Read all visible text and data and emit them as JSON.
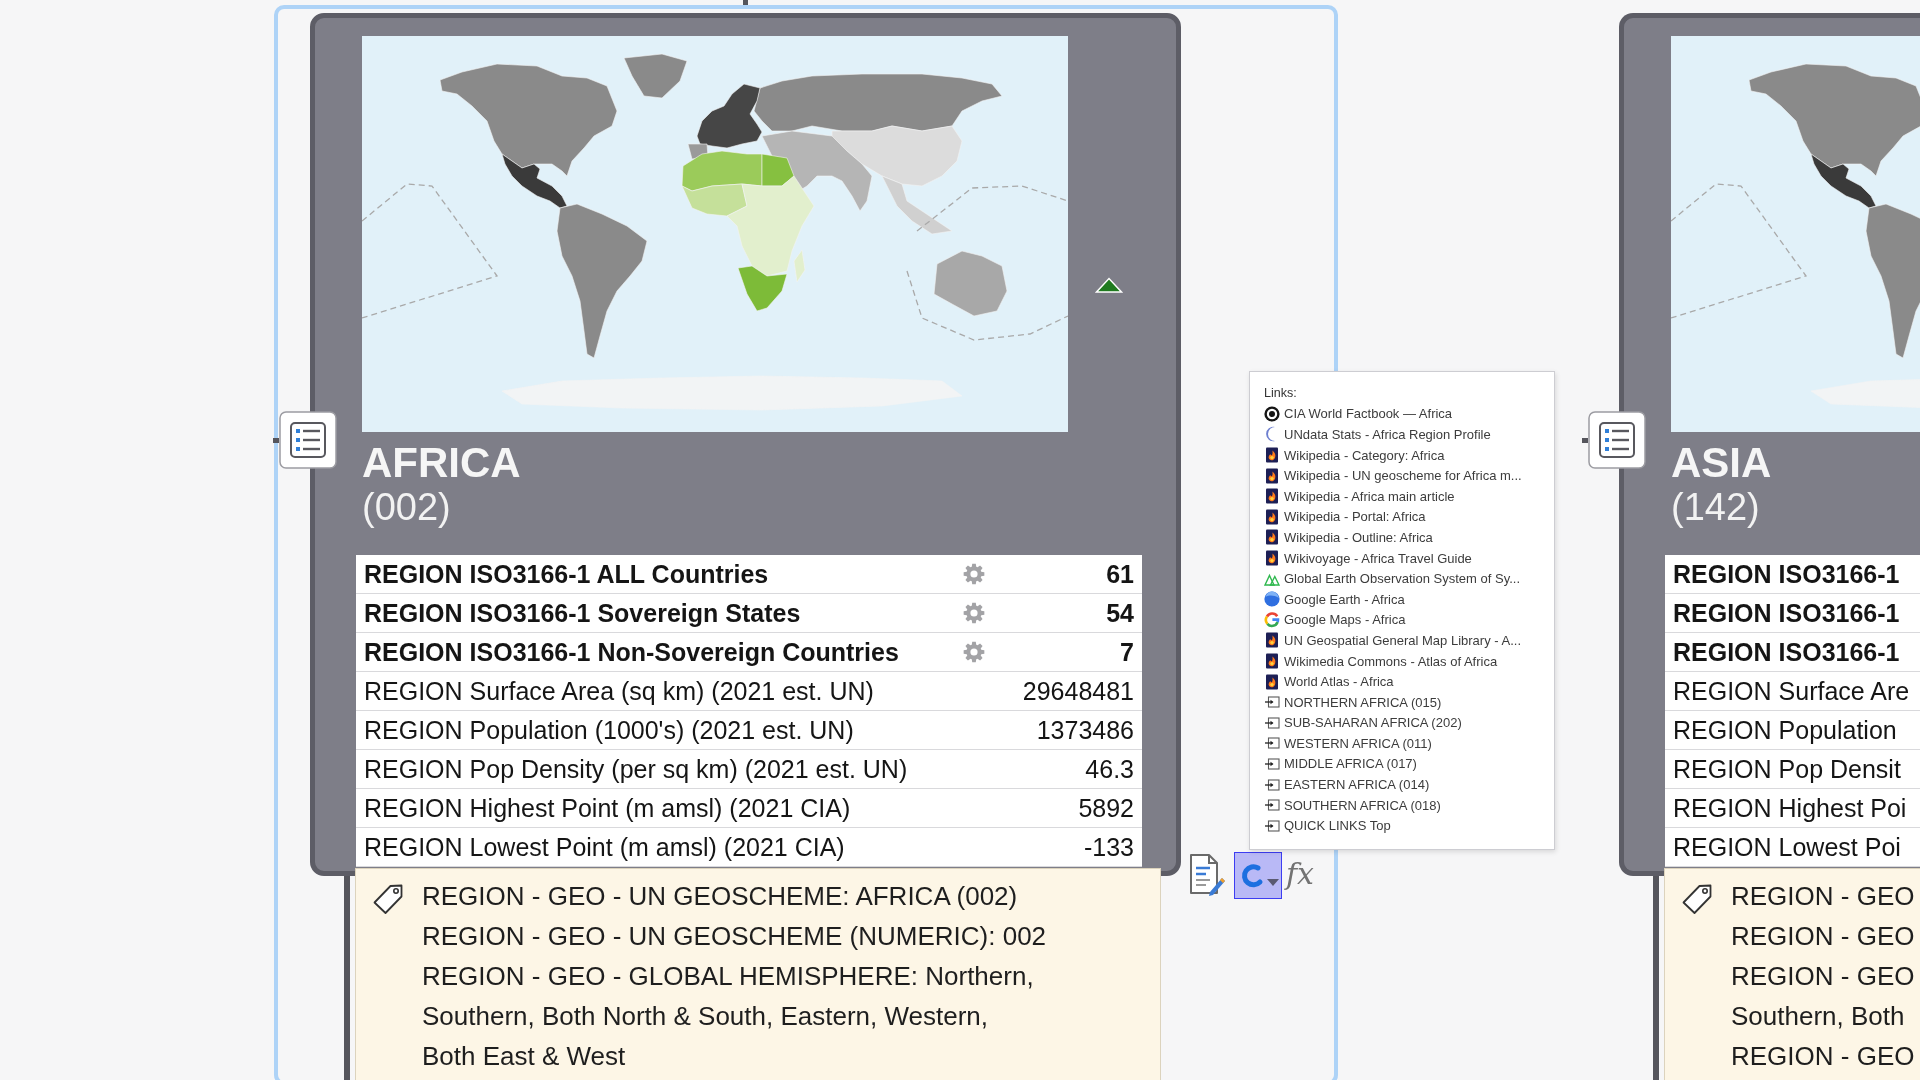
{
  "topics": [
    {
      "title": "AFRICA",
      "code": "(002)",
      "selected": true,
      "collapse_marker": true,
      "stats": [
        {
          "kind": "count",
          "label": "REGION ISO3166-1 ALL Countries",
          "value": "61"
        },
        {
          "kind": "count",
          "label": "REGION ISO3166-1 Sovereign States",
          "value": "54"
        },
        {
          "kind": "count",
          "label": "REGION ISO3166-1 Non-Sovereign Countries",
          "value": "7"
        },
        {
          "kind": "stat",
          "label": "REGION Surface Area (sq km) (2021 est. UN)",
          "value": "29648481"
        },
        {
          "kind": "stat",
          "label": "REGION Population (1000's) (2021 est. UN)",
          "value": "1373486"
        },
        {
          "kind": "stat",
          "label": "REGION Pop Density (per sq km) (2021 est. UN)",
          "value": "46.3"
        },
        {
          "kind": "stat",
          "label": "REGION Highest Point (m amsl) (2021 CIA)",
          "value": "5892"
        },
        {
          "kind": "stat",
          "label": "REGION Lowest Point (m amsl) (2021 CIA)",
          "value": "-133"
        }
      ],
      "tags": [
        {
          "lines": [
            "REGION - GEO - UN GEOSCHEME: AFRICA (002)"
          ]
        },
        {
          "lines": [
            "REGION - GEO - UN GEOSCHEME (NUMERIC): 002"
          ]
        },
        {
          "lines": [
            "REGION - GEO - GLOBAL HEMISPHERE: Northern,",
            "Southern, Both North & South, Eastern, Western,",
            "Both East & West"
          ]
        }
      ]
    },
    {
      "title": "ASIA",
      "code": "(142)",
      "selected": false,
      "stats": [
        {
          "kind": "count",
          "label": "REGION ISO3166-1"
        },
        {
          "kind": "count",
          "label": "REGION ISO3166-1"
        },
        {
          "kind": "count",
          "label": "REGION ISO3166-1"
        },
        {
          "kind": "stat",
          "label": "REGION Surface Are"
        },
        {
          "kind": "stat",
          "label": "REGION Population"
        },
        {
          "kind": "stat",
          "label": "REGION Pop Densit"
        },
        {
          "kind": "stat",
          "label": "REGION Highest Poi"
        },
        {
          "kind": "stat",
          "label": "REGION Lowest Poi"
        }
      ],
      "tags": [
        {
          "lines": [
            "REGION - GEO"
          ]
        },
        {
          "lines": [
            "REGION - GEO"
          ]
        },
        {
          "lines": [
            "REGION - GEO",
            "Southern, Both"
          ]
        },
        {
          "lines": [
            "REGION - GEO"
          ]
        }
      ]
    }
  ],
  "tools": {
    "link_button": {
      "open": true
    },
    "formula_label": "fx"
  },
  "links_popup": {
    "heading": "Links:",
    "items": [
      {
        "kind": "seal",
        "label": "CIA World Factbook — Africa"
      },
      {
        "kind": "un",
        "label": "UNdata Stats - Africa Region Profile"
      },
      {
        "kind": "web",
        "label": "Wikipedia - Category: Africa"
      },
      {
        "kind": "web",
        "label": "Wikipedia - UN geoscheme for Africa m..."
      },
      {
        "kind": "web",
        "label": "Wikipedia - Africa main article"
      },
      {
        "kind": "web",
        "label": "Wikipedia - Portal: Africa"
      },
      {
        "kind": "web",
        "label": "Wikipedia - Outline: Africa"
      },
      {
        "kind": "web",
        "label": "Wikivoyage - Africa Travel Guide"
      },
      {
        "kind": "geo",
        "label": "Global Earth Observation System of Sy..."
      },
      {
        "kind": "earth",
        "label": "Google Earth - Africa"
      },
      {
        "kind": "maps",
        "label": "Google Maps - Africa"
      },
      {
        "kind": "web",
        "label": "UN Geospatial General Map Library - A..."
      },
      {
        "kind": "web",
        "label": "Wikimedia Commons - Atlas of Africa"
      },
      {
        "kind": "web",
        "label": "World Atlas - Africa"
      },
      {
        "kind": "topic",
        "label": "NORTHERN AFRICA (015)"
      },
      {
        "kind": "topic",
        "label": "SUB-SAHARAN AFRICA (202)"
      },
      {
        "kind": "topic",
        "label": "WESTERN AFRICA (011)"
      },
      {
        "kind": "topic",
        "label": "MIDDLE AFRICA (017)"
      },
      {
        "kind": "topic",
        "label": "EASTERN AFRICA (014)"
      },
      {
        "kind": "topic",
        "label": "SOUTHERN AFRICA (018)"
      },
      {
        "kind": "topic",
        "label": "QUICK LINKS Top"
      }
    ]
  }
}
